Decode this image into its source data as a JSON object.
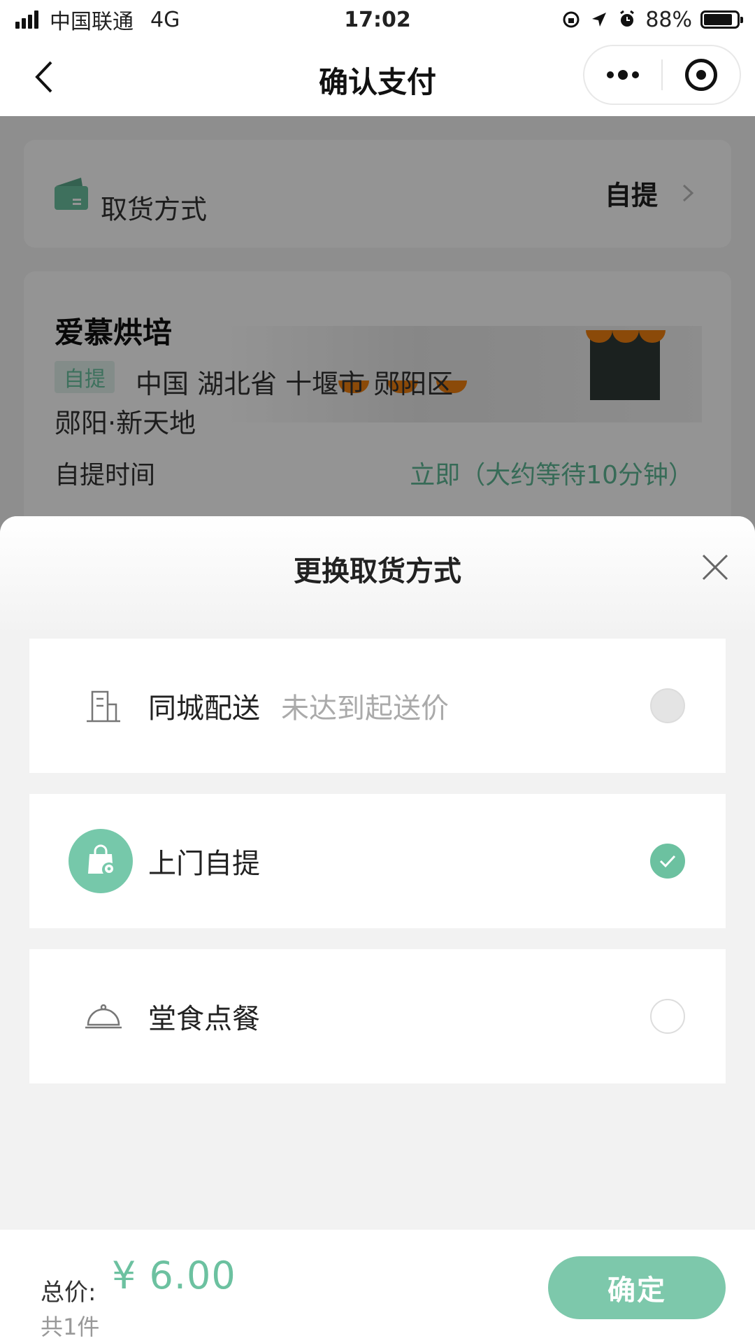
{
  "status_bar": {
    "carrier": "中国联通",
    "network": "4G",
    "time": "17:02",
    "battery": "88%",
    "battery_level": 0.88
  },
  "nav": {
    "title": "确认支付",
    "icons": [
      "back-icon",
      "more-dots-icon",
      "close-miniprogram-icon"
    ]
  },
  "background": {
    "pickup_label": "取货方式",
    "pickup_value": "自提",
    "store_name": "爱慕烘培",
    "badge": "自提",
    "address_line1": "中国 湖北省 十堰市 郧阳区",
    "address_line2": "郧阳·新天地",
    "time_label": "自提时间",
    "time_value": "立即（大约等待10分钟）"
  },
  "sheet": {
    "title": "更换取货方式",
    "options": [
      {
        "label": "同城配送",
        "note": "未达到起送价",
        "state": "disabled",
        "icon": "building-icon"
      },
      {
        "label": "上门自提",
        "note": "",
        "state": "checked",
        "icon": "pickup-bag-icon"
      },
      {
        "label": "堂食点餐",
        "note": "",
        "state": "unchecked",
        "icon": "cloche-icon"
      }
    ]
  },
  "footer": {
    "total_label": "总价:",
    "total_price": "¥ 6.00",
    "count": "共1件",
    "confirm_label": "确定"
  },
  "colors": {
    "accent": "#6cc1a0",
    "accent_light": "#7dc8ab",
    "badge_bg": "#e2f2ec",
    "dim_overlay": "rgba(0,0,0,0.42)"
  }
}
